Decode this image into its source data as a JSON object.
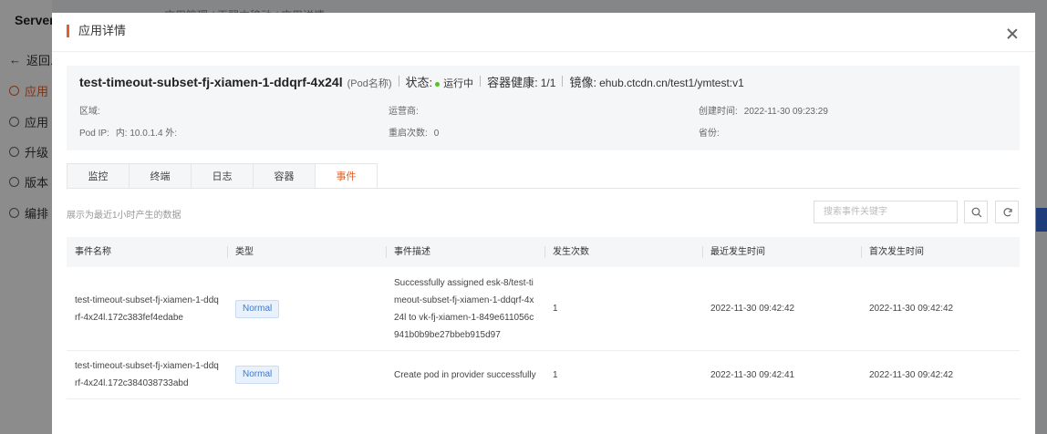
{
  "background": {
    "brand": "Server",
    "breadcrumb": "应用管理 / 天翼中移动 / 应用详情",
    "nav": [
      {
        "label": "返回..."
      },
      {
        "label": "应用"
      },
      {
        "label": "应用"
      },
      {
        "label": "升级"
      },
      {
        "label": "版本"
      },
      {
        "label": "编排"
      }
    ]
  },
  "modal": {
    "title": "应用详情",
    "close_label": "×"
  },
  "pod": {
    "name": "test-timeout-subset-fj-xiamen-1-ddqrf-4x24l",
    "name_suffix": "(Pod名称)",
    "status_label": "状态:",
    "status_value": "运行中",
    "health_label": "容器健康:",
    "health_value": "1/1",
    "image_label": "镜像:",
    "image_value": "ehub.ctcdn.cn/test1/ymtest:v1",
    "region_label": "区域:",
    "region_value": "",
    "operator_label": "运营商:",
    "operator_value": "",
    "created_label": "创建时间:",
    "created_value": "2022-11-30 09:23:29",
    "podip_label": "Pod IP:",
    "podip_value": "内: 10.0.1.4  外:",
    "restart_label": "重启次数:",
    "restart_value": "0",
    "province_label": "省份:",
    "province_value": ""
  },
  "tabs": [
    {
      "label": "监控"
    },
    {
      "label": "终端"
    },
    {
      "label": "日志"
    },
    {
      "label": "容器"
    },
    {
      "label": "事件"
    }
  ],
  "events": {
    "hint": "展示为最近1小时产生的数据",
    "search_placeholder": "搜索事件关键字",
    "columns": [
      "事件名称",
      "类型",
      "事件描述",
      "发生次数",
      "最近发生时间",
      "首次发生时间"
    ],
    "rows": [
      {
        "name": "test-timeout-subset-fj-xiamen-1-ddqrf-4x24l.172c383fef4edabe",
        "type": "Normal",
        "desc": "Successfully assigned esk-8/test-timeout-subset-fj-xiamen-1-ddqrf-4x24l to vk-fj-xiamen-1-849e611056c941b0b9be27bbeb915d97",
        "count": "1",
        "last": "2022-11-30 09:42:42",
        "first": "2022-11-30 09:42:42"
      },
      {
        "name": "test-timeout-subset-fj-xiamen-1-ddqrf-4x24l.172c384038733abd",
        "type": "Normal",
        "desc": "Create pod in provider successfully",
        "count": "1",
        "last": "2022-11-30 09:42:41",
        "first": "2022-11-30 09:42:42"
      }
    ]
  },
  "colors": {
    "accent": "#e2602a",
    "status_ok": "#52c41a",
    "badge_text": "#3b7bd6"
  }
}
